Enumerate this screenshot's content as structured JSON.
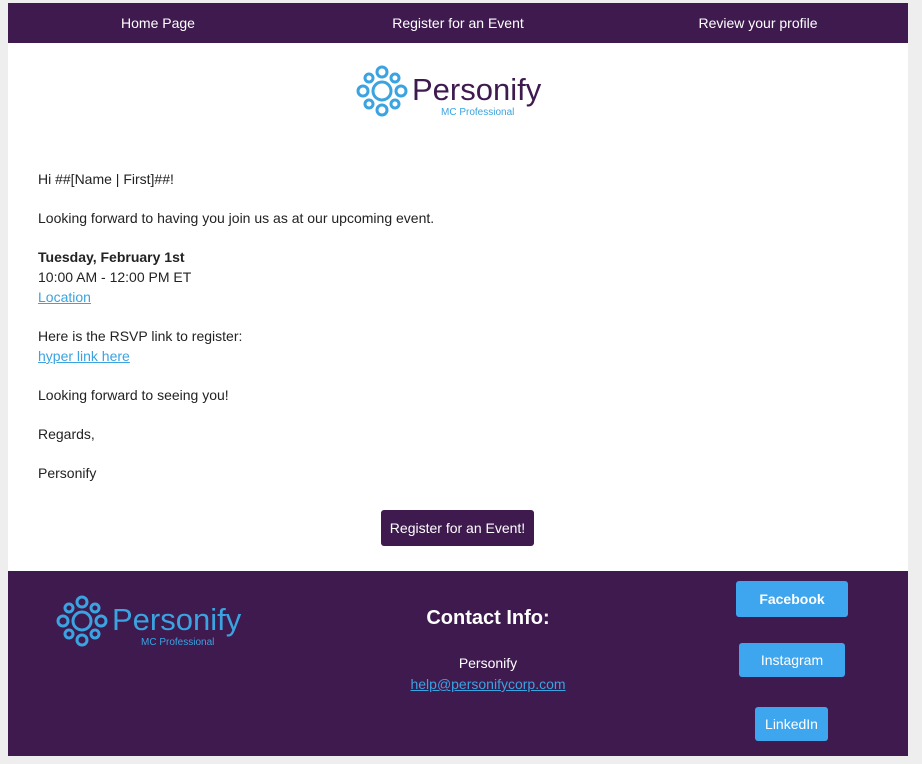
{
  "nav": {
    "home": "Home Page",
    "register": "Register for an Event",
    "profile": "Review your profile"
  },
  "logo": {
    "name": "Personify",
    "tagline": "MC Professional"
  },
  "email": {
    "greeting": "Hi ##[Name | First]##!",
    "intro": "Looking forward to having you join us as at our upcoming event.",
    "event_date": "Tuesday, February 1st",
    "event_time": "10:00 AM - 12:00 PM ET",
    "location_link": "Location",
    "rsvp_text": "Here is the RSVP link to register:",
    "rsvp_link": "hyper link here",
    "closing": "Looking forward to seeing you!",
    "regards": "Regards,",
    "signature": "Personify",
    "cta_label": "Register for an Event!"
  },
  "footer": {
    "contact_title": "Contact Info:",
    "contact_name": "Personify",
    "contact_email": "help@personifycorp.com",
    "facebook": "Facebook",
    "instagram": "Instagram",
    "linkedin": "LinkedIn"
  },
  "colors": {
    "brand_purple": "#3e1a4f",
    "accent_blue": "#3ea5ef",
    "logo_blue": "#3aa3e0",
    "background": "#eeeeee"
  }
}
